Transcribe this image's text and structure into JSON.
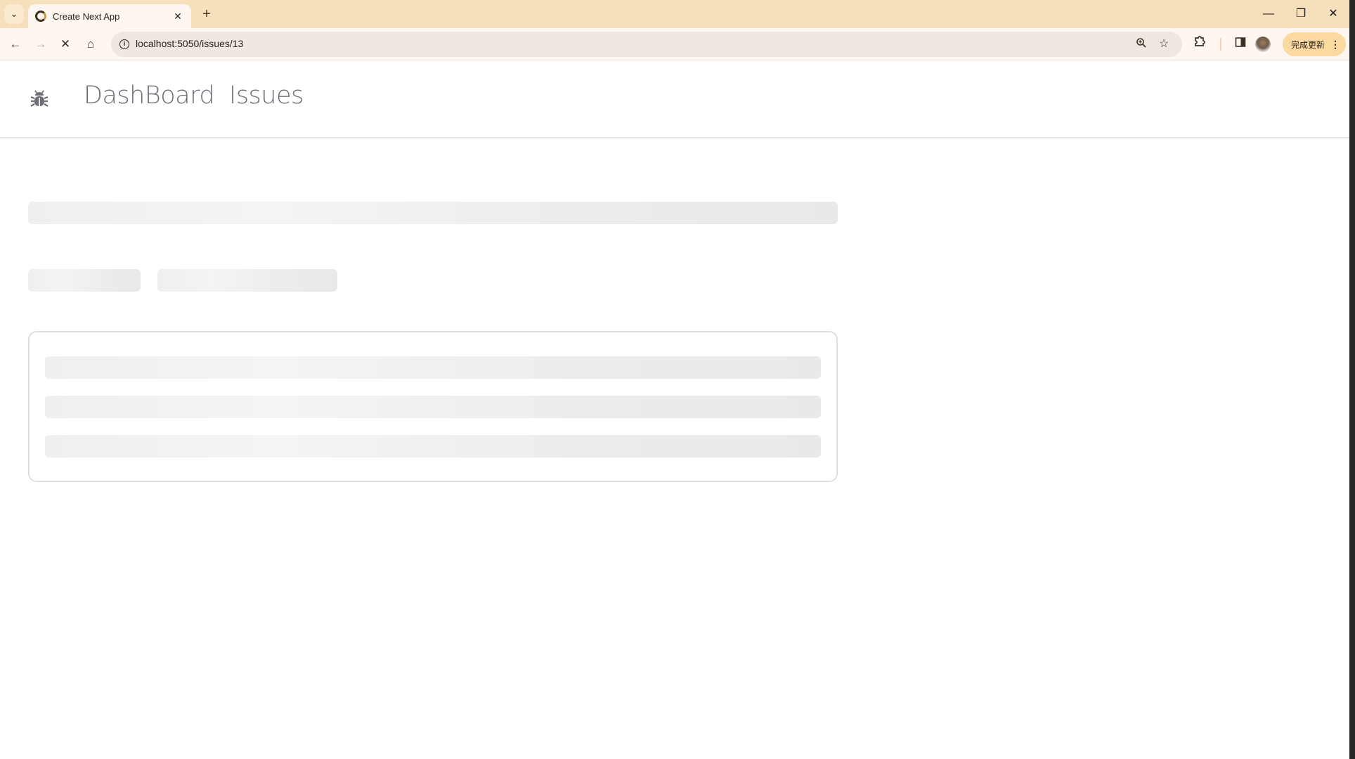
{
  "browser": {
    "tab": {
      "title": "Create Next App",
      "favicon": "nextjs-favicon-icon",
      "close_icon": "close-icon"
    },
    "new_tab_label": "+",
    "window_controls": {
      "minimize": "—",
      "restore": "❐",
      "close": "✕"
    },
    "toolbar": {
      "back": "←",
      "forward": "→",
      "stop": "✕",
      "home": "⌂",
      "url": "localhost:5050/issues/13",
      "zoom_icon": "zoom-icon",
      "bookmark_icon": "☆",
      "extensions_icon": "extensions-icon",
      "sidepanel_icon": "sidepanel-icon",
      "update_label": "完成更新",
      "menu_icon": "⋮"
    },
    "colors": {
      "tabbar": "#f6dfbb",
      "toolbar": "#fef7f1",
      "omnibox": "#f0e7e0",
      "update_button": "#fcd9a0"
    }
  },
  "navbar": {
    "logo_icon": "bug-icon",
    "links": [
      {
        "label": "DashBoard"
      },
      {
        "label": "Issues"
      }
    ],
    "link_color": "#6e6e78"
  },
  "content": {
    "state": "loading",
    "skeletons": {
      "title": 1,
      "badges": 2,
      "card_lines": 3
    },
    "skeleton_color": "#ececec"
  }
}
